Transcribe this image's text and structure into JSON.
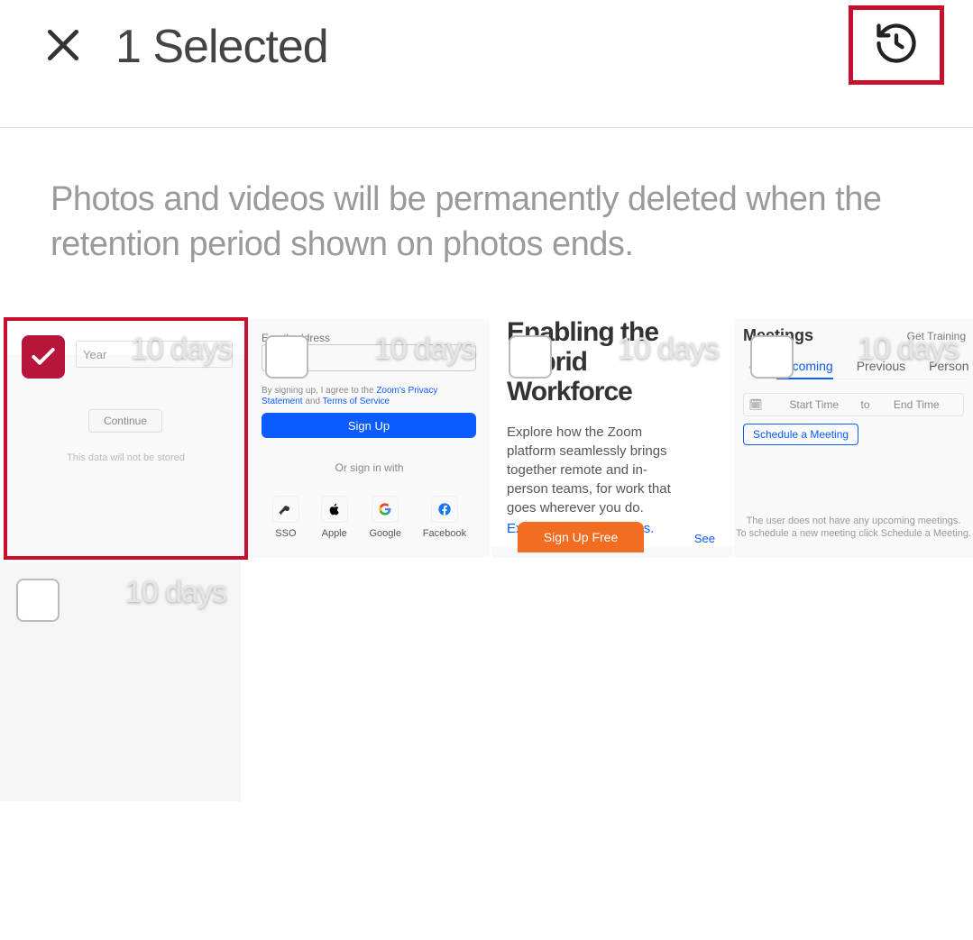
{
  "header": {
    "title": "1 Selected"
  },
  "message": "Photos and videos will be permanently deleted when the retention period shown on photos ends.",
  "badge": "10 days",
  "cards": {
    "c1": {
      "year_label": "Year",
      "continue": "Continue",
      "not_stored": "This data will not be stored"
    },
    "c2": {
      "email_label": "Email address",
      "terms_prefix": "By signing up, I agree to the ",
      "privacy": "Zoom's Privacy Statement",
      "and": " and ",
      "tos": "Terms of Service",
      "signup": "Sign Up",
      "or": "Or sign in with",
      "providers": {
        "sso": "SSO",
        "apple": "Apple",
        "google": "Google",
        "facebook": "Facebook"
      }
    },
    "c3": {
      "title_line1": "Enabling the",
      "title_line2": "Hybrid",
      "title_line3": "Workforce",
      "text": "Explore how the Zoom platform seamlessly brings together remote and in-person teams, for work that goes wherever you do.",
      "link": "Explore hybrid solutions.",
      "signup_free": "Sign Up Free",
      "see": "See"
    },
    "c4": {
      "title": "Meetings",
      "get_training": "Get Training",
      "tabs": {
        "upcoming": "Upcoming",
        "previous": "Previous",
        "personal": "Person"
      },
      "start_time": "Start Time",
      "to": "to",
      "end_time": "End Time",
      "schedule": "Schedule a Meeting",
      "empty1": "The user does not have any upcoming meetings.",
      "empty2": "To schedule a new meeting click Schedule a Meeting."
    }
  }
}
